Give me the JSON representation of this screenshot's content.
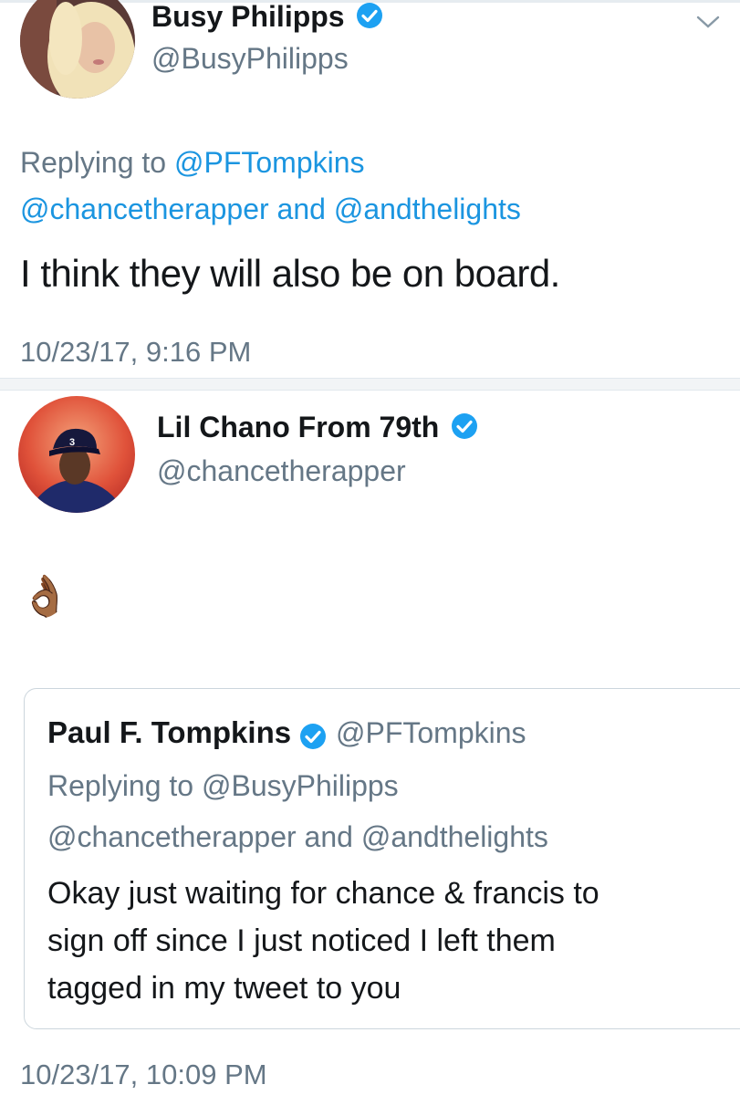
{
  "tweet1": {
    "display_name": "Busy Philipps",
    "handle": "@BusyPhilipps",
    "replying_prefix": "Replying to",
    "replying_user": "@PFTompkins",
    "mention1": "@chancetherapper",
    "and_word": "and",
    "mention2": "@andthelights",
    "text": "I think they will also be on board.",
    "timestamp": "10/23/17, 9:16 PM"
  },
  "tweet2": {
    "display_name": "Lil Chano From 79th",
    "handle": "@chancetherapper",
    "avatar_cap_number": "3",
    "emoji": "👌🏾",
    "timestamp": "10/23/17, 10:09 PM",
    "quoted": {
      "display_name": "Paul F. Tompkins",
      "handle": "@PFTompkins",
      "replying_prefix": "Replying to",
      "replying_user": "@BusyPhilipps",
      "mention1": "@chancetherapper",
      "and_word": "and",
      "mention2": "@andthelights",
      "text_line1": "Okay just waiting for chance & francis to",
      "text_line2": "sign off since I just noticed I left them",
      "text_line3": "tagged in my tweet to you"
    }
  },
  "colors": {
    "link": "#1b95e0",
    "verified": "#1da1f2",
    "secondary_text": "#657786",
    "primary_text": "#14171a"
  },
  "icons": [
    "verified-badge-icon",
    "chevron-down-icon",
    "ok-hand-emoji"
  ]
}
